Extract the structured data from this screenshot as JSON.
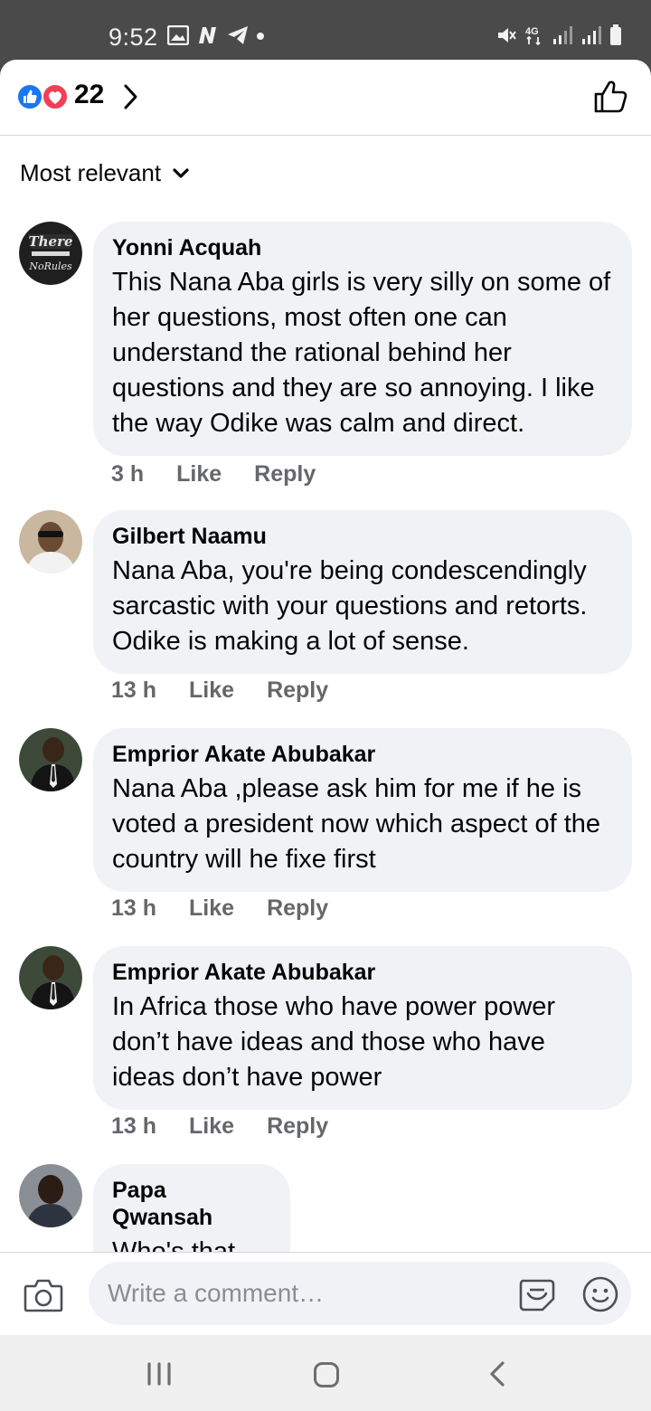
{
  "status_bar": {
    "time": "9:52",
    "network": "4G"
  },
  "reactions": {
    "count": "22"
  },
  "sort": {
    "label": "Most relevant"
  },
  "comments": [
    {
      "author": "Yonni Acquah",
      "text": "This Nana Aba girls is very silly on some of her questions, most often one can understand the rational behind her questions and they are so annoying. I like the way Odike was calm and direct.",
      "time": "3 h",
      "like": "Like",
      "reply": "Reply"
    },
    {
      "author": "Gilbert Naamu",
      "text": "Nana Aba, you're being condescendingly sarcastic with your questions and retorts. Odike is making a lot of sense.",
      "time": "13 h",
      "like": "Like",
      "reply": "Reply"
    },
    {
      "author": "Emprior Akate Abubakar",
      "text": "Nana Aba ,please ask him for me if he is voted a  president now which aspect of the country will he fixe first",
      "time": "13 h",
      "like": "Like",
      "reply": "Reply"
    },
    {
      "author": "Emprior Akate Abubakar",
      "text": "In Africa those who have power power don’t have ideas and those who have ideas don’t have power",
      "time": "13 h",
      "like": "Like",
      "reply": "Reply"
    },
    {
      "author": "Papa Qwansah",
      "text": "Who's that"
    }
  ],
  "composer": {
    "placeholder": "Write a comment…"
  },
  "colors": {
    "like_blue": "#1877f2",
    "love_red": "#f33e58",
    "bubble_bg": "#f0f2f5",
    "meta_gray": "#65676b"
  },
  "icons": [
    "like-reaction-icon",
    "love-reaction-icon",
    "chevron-right-icon",
    "thumbs-up-icon",
    "chevron-down-icon",
    "camera-icon",
    "sticker-icon",
    "emoji-icon",
    "nav-recents-icon",
    "nav-home-icon",
    "nav-back-icon"
  ]
}
